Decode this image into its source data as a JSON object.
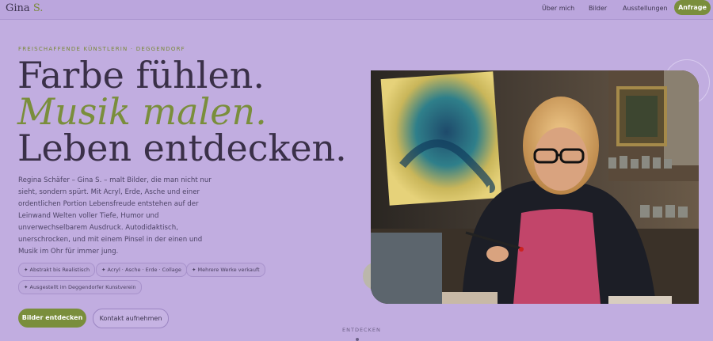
{
  "header": {
    "logo_name": "Gina",
    "logo_initial": "S.",
    "nav": [
      "Über mich",
      "Bilder",
      "Ausstellungen"
    ],
    "cta": "Anfrage"
  },
  "hero": {
    "eyebrow": "FREISCHAFFENDE KÜNSTLERIN · DEGGENDORF",
    "headline": [
      "Farbe fühlen.",
      "Musik malen.",
      "Leben entdecken."
    ],
    "intro": "Regina Schäfer – Gina S. – malt Bilder, die man nicht nur sieht, sondern spürt. Mit Acryl, Erde, Asche und einer ordentlichen Portion Lebensfreude entstehen auf der Leinwand Welten voller Tiefe, Humor und unverwechselbarem Ausdruck. Autodidaktisch, unerschrocken, und mit einem Pinsel in der einen und Musik im Ohr für immer jung.",
    "chips": [
      "✦ Abstrakt bis Realistisch",
      "✦ Acryl · Asche · Erde · Collage",
      "✦ Mehrere Werke verkauft",
      "✦ Ausgestellt im Deggendorfer Kunstverein"
    ],
    "primary_button": "Bilder entdecken",
    "secondary_button": "Kontakt aufnehmen",
    "scroll_label": "ENTDECKEN"
  },
  "colors": {
    "background": "#c1ade0",
    "accent": "#7a8e3c",
    "text": "#3a3048"
  }
}
